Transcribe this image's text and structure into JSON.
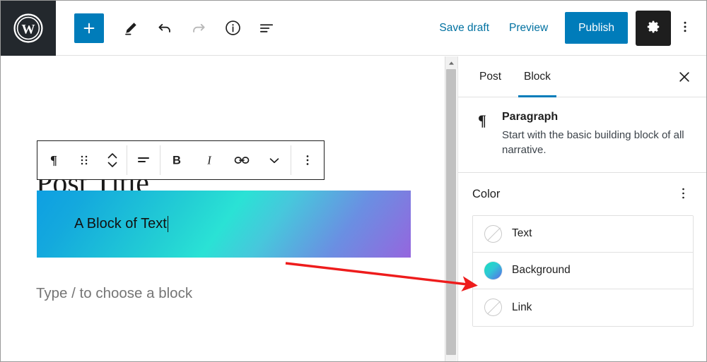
{
  "app": {
    "name": "WordPress Block Editor",
    "logo_icon": "wordpress-logo-icon"
  },
  "header": {
    "add_block_label": "+",
    "add_block_icon": "plus-icon",
    "tools": [
      {
        "icon": "pencil-edit-icon",
        "name": "tools-mode"
      },
      {
        "icon": "undo-arrow-icon",
        "name": "undo"
      },
      {
        "icon": "redo-arrow-icon",
        "name": "redo"
      },
      {
        "icon": "info-circle-icon",
        "name": "details"
      },
      {
        "icon": "list-view-icon",
        "name": "list-view"
      }
    ],
    "save_draft_label": "Save draft",
    "preview_label": "Preview",
    "publish_label": "Publish",
    "settings_icon": "gear-icon",
    "more_options_icon": "kebab-vertical-icon",
    "accent_color": "#007cba",
    "logo_background": "#23282d"
  },
  "editor": {
    "post_title": "Post Title",
    "placeholder": "Type / to choose a block",
    "block_text": "A Block of Text",
    "gradient_css": "linear-gradient(125deg, #0e9fe2 0%, #2ae2d5 50%, #9566de 100%)",
    "gradient_stops": [
      "#0e9fe2",
      "#2ae2d5",
      "#9566de"
    ],
    "block_toolbar": [
      {
        "icon": "paragraph-pilcrow-icon",
        "name": "block-type"
      },
      {
        "icon": "drag-handle-icon",
        "name": "drag-handle"
      },
      {
        "icon": "move-up-down-icon",
        "name": "move-block"
      },
      {
        "icon": "align-text-icon",
        "name": "text-align"
      },
      {
        "icon": "bold-icon",
        "name": "bold",
        "label": "B"
      },
      {
        "icon": "italic-icon",
        "name": "italic",
        "label": "I"
      },
      {
        "icon": "link-icon",
        "name": "link"
      },
      {
        "icon": "chevron-down-icon",
        "name": "more-formatting"
      },
      {
        "icon": "kebab-vertical-icon",
        "name": "block-options"
      }
    ]
  },
  "scrollbar": {
    "up_arrow_icon": "caret-up-icon",
    "thumb_color": "#c1c1c1",
    "track_color": "#f1f1f1"
  },
  "sidebar": {
    "tabs": [
      {
        "label": "Post",
        "active": false
      },
      {
        "label": "Block",
        "active": true
      }
    ],
    "close_icon": "close-x-icon",
    "block_info": {
      "icon": "paragraph-pilcrow-icon",
      "title": "Paragraph",
      "description": "Start with the basic building block of all narrative."
    },
    "color_panel": {
      "title": "Color",
      "options_icon": "kebab-vertical-icon",
      "rows": [
        {
          "label": "Text",
          "swatch": "none",
          "swatch_icon": "no-color-icon"
        },
        {
          "label": "Background",
          "swatch": "gradient",
          "swatch_icon": "gradient-swatch-icon"
        },
        {
          "label": "Link",
          "swatch": "none",
          "swatch_icon": "no-color-icon"
        }
      ]
    }
  },
  "annotation": {
    "arrow_color": "#ee1c1c",
    "arrow_from": "403,372",
    "arrow_to": "668,404",
    "points_at": "Background"
  }
}
